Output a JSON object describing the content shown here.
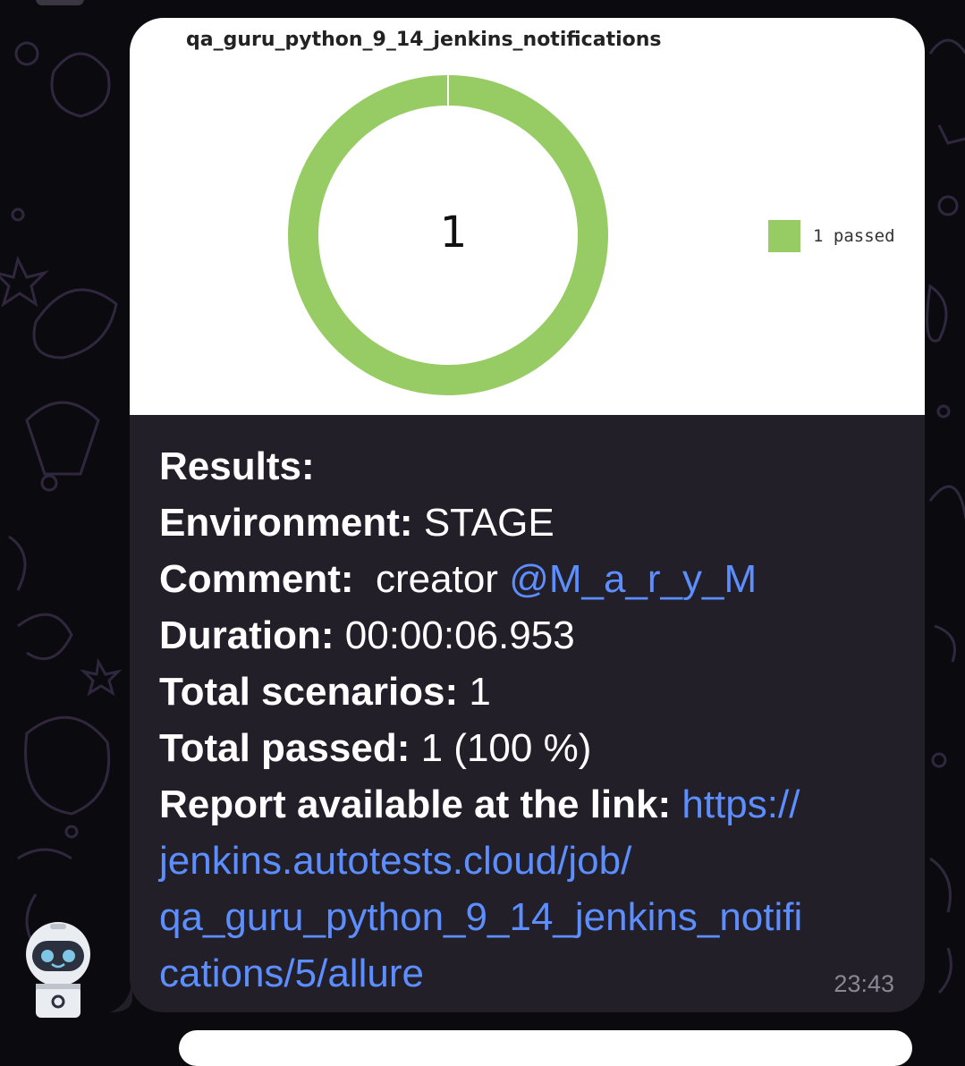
{
  "chart": {
    "title": "qa_guru_python_9_14_jenkins_notifications",
    "center_value": "1",
    "legend_label": "1 passed",
    "passed_color": "#97cc64"
  },
  "message": {
    "results_label": "Results:",
    "environment_label": "Environment:",
    "environment_value": "STAGE",
    "comment_label": "Comment:",
    "comment_value": "creator",
    "comment_mention": "@M_a_r_y_M",
    "duration_label": "Duration:",
    "duration_value": "00:00:06.953",
    "total_scenarios_label": "Total scenarios:",
    "total_scenarios_value": "1",
    "total_passed_label": "Total passed:",
    "total_passed_value": "1 (100 %)",
    "report_label": "Report available at the link:",
    "report_link_lines": [
      "https://",
      "jenkins.autotests.cloud/job/",
      "qa_guru_python_9_14_jenkins_notifi",
      "cations/5/allure"
    ],
    "time": "23:43"
  },
  "colors": {
    "link": "#5d8eff",
    "bubble_bg": "#221f29",
    "page_bg": "#0b0a0f"
  },
  "icons": {
    "avatar": "robot-avatar-icon"
  }
}
